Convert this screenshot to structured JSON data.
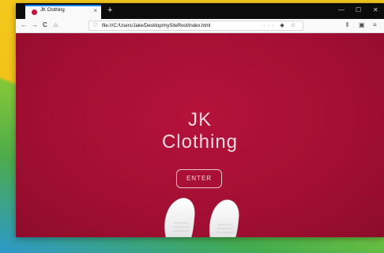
{
  "browser": {
    "tab": {
      "title": "JK Clothing",
      "close": "×"
    },
    "new_tab": "+",
    "window_controls": {
      "minimize": "—",
      "maximize": "☐",
      "close": "✕"
    },
    "nav": {
      "back": "←",
      "forward": "→",
      "reload": "C",
      "home": "⌂"
    },
    "url_info": "ⓘ",
    "url": "file:///C:/Users/Jake/Desktop/mySiteRoot/index.html",
    "url_actions": "··· ◆ ☆",
    "toolbar": {
      "library": "⦀",
      "sidebar": "▣",
      "menu": "≡"
    }
  },
  "page": {
    "brand_line1": "JK",
    "brand_line2": "Clothing",
    "enter_label": "ENTER"
  },
  "colors": {
    "page_background": "#a40f33",
    "tab_accent": "#0a84ff"
  }
}
